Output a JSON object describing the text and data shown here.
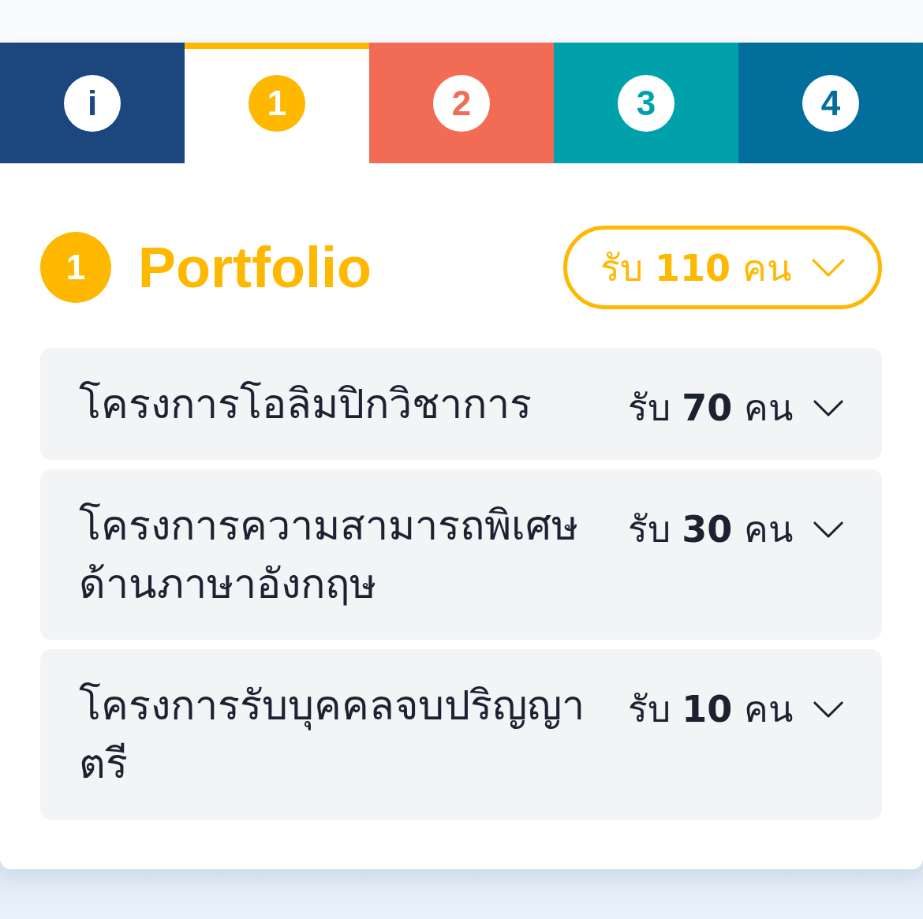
{
  "tabs": [
    {
      "label": "i",
      "selected": false,
      "color": "#1b467e"
    },
    {
      "label": "1",
      "selected": true,
      "color": "#ffb800"
    },
    {
      "label": "2",
      "selected": false,
      "color": "#f26c55"
    },
    {
      "label": "3",
      "selected": false,
      "color": "#00a1aa"
    },
    {
      "label": "4",
      "selected": false,
      "color": "#026e9c"
    }
  ],
  "section": {
    "number": "1",
    "title": "Portfolio",
    "total_quota": {
      "text": "รับ **110** คน",
      "expanded": false
    }
  },
  "programs": [
    {
      "title": "โครงการโอลิมปิกวิชาการ",
      "quota": "รับ **70** คน",
      "expanded": false
    },
    {
      "title": "โครงการความสามารถพิเศษด้านภาษาอังกฤษ",
      "quota": "รับ **30** คน",
      "expanded": false
    },
    {
      "title": "โครงการรับบุคคลจบปริญญาตรี",
      "quota": "รับ **10** คน",
      "expanded": false
    }
  ]
}
